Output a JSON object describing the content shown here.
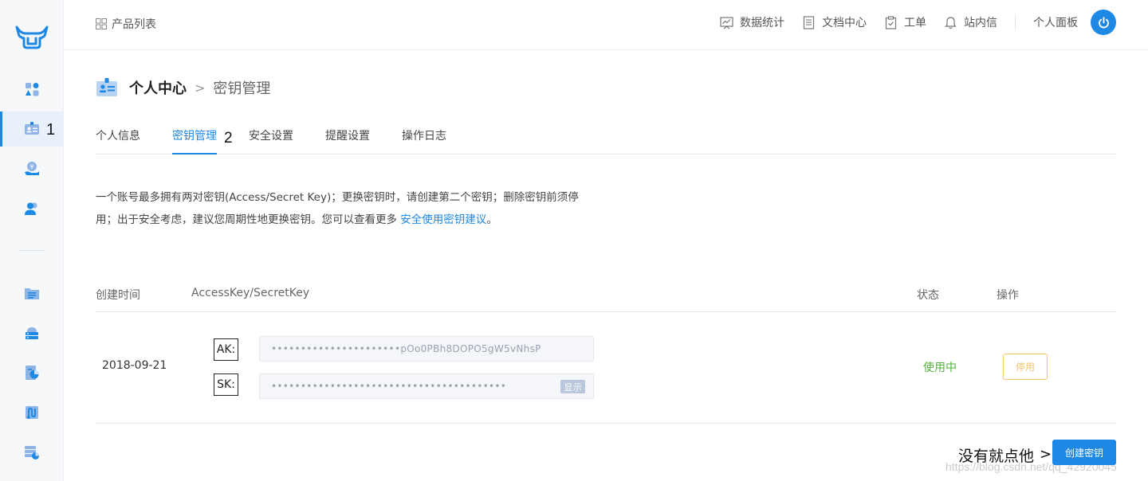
{
  "sidebar": {
    "annotation": "1"
  },
  "topbar": {
    "product_list": "产品列表",
    "links": [
      {
        "label": "数据统计",
        "icon": "chart-icon"
      },
      {
        "label": "文档中心",
        "icon": "document-icon"
      },
      {
        "label": "工单",
        "icon": "ticket-icon"
      },
      {
        "label": "站内信",
        "icon": "bell-icon"
      }
    ],
    "panel_label": "个人面板"
  },
  "breadcrumb": {
    "root": "个人中心",
    "separator": ">",
    "current": "密钥管理"
  },
  "tabs": [
    {
      "label": "个人信息"
    },
    {
      "label": "密钥管理"
    },
    {
      "label": "安全设置"
    },
    {
      "label": "提醒设置"
    },
    {
      "label": "操作日志"
    }
  ],
  "tab_annotation": "2",
  "description": {
    "line1": "一个账号最多拥有两对密钥(Access/Secret Key)；更换密钥时，请创建第二个密钥；删除密钥前须停",
    "line2_prefix": "用；出于安全考虑，建议您周期性地更换密钥。您可以查看更多 ",
    "link": "安全使用密钥建议",
    "line2_suffix": "。"
  },
  "table": {
    "headers": {
      "created": "创建时间",
      "keys": "AccessKey/SecretKey",
      "status": "状态",
      "actions": "操作"
    },
    "row": {
      "date": "2018-09-21",
      "ak_label": "AK:",
      "ak_value": "••••••••••••••••••••••pOo0PBh8DOPO5gW5vNhsP",
      "sk_label": "SK:",
      "sk_value": "••••••••••••••••••••••••••••••••••••••••",
      "show_label": "显示",
      "status": "使用中",
      "disable_label": "停用"
    }
  },
  "footer": {
    "annotation": "没有就点他",
    "arrow": ">",
    "create_label": "创建密钥",
    "watermark": "https://blog.csdn.net/qq_42920045"
  },
  "colors": {
    "accent": "#1e88e5",
    "success": "#52b13a",
    "warning": "#f2c572"
  }
}
